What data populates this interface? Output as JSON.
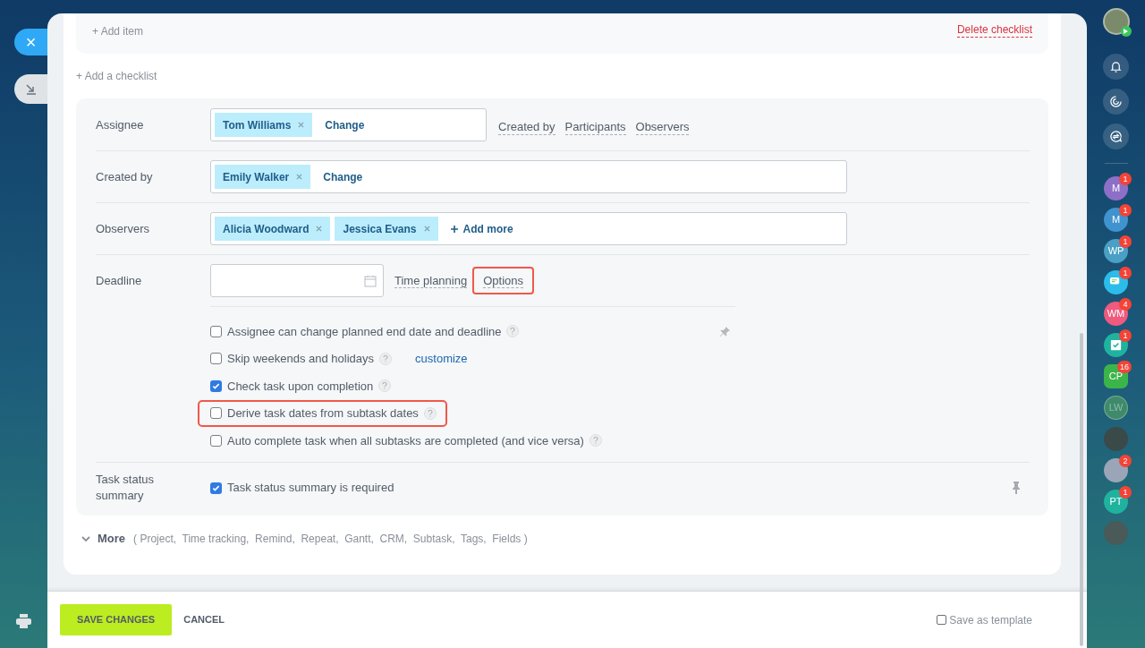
{
  "left_strip": {
    "close": "×"
  },
  "checklist": {
    "add_item": "+ Add item",
    "delete": "Delete checklist",
    "add_checklist": "+ Add a checklist"
  },
  "rows": [
    {
      "label": "Assignee",
      "people": [
        "Tom Williams"
      ],
      "action": "Change",
      "plus": false,
      "wide": false,
      "links": [
        "Created by",
        "Participants",
        "Observers"
      ]
    },
    {
      "label": "Created by",
      "people": [
        "Emily Walker"
      ],
      "action": "Change",
      "plus": false,
      "wide": true,
      "links": []
    },
    {
      "label": "Observers",
      "people": [
        "Alicia Woodward",
        "Jessica Evans"
      ],
      "action": "Add more",
      "plus": true,
      "wide": true,
      "links": []
    }
  ],
  "deadline": {
    "label": "Deadline",
    "links": [
      {
        "text": "Time planning",
        "highlighted": false
      },
      {
        "text": "Options",
        "highlighted": true
      }
    ]
  },
  "options": [
    {
      "label": "Assignee can change planned end date and deadline",
      "checked": false,
      "highlighted": false,
      "pin": true
    },
    {
      "label": "Skip weekends and holidays",
      "checked": false,
      "highlighted": false,
      "pin": false,
      "link": "customize"
    },
    {
      "label": "Check task upon completion",
      "checked": true,
      "highlighted": false,
      "pin": false
    },
    {
      "label": "Derive task dates from subtask dates",
      "checked": false,
      "highlighted": true,
      "pin": false
    },
    {
      "label": "Auto complete task when all subtasks are completed (and vice versa)",
      "checked": false,
      "highlighted": false,
      "pin": false
    }
  ],
  "status_summary": {
    "label": "Task status summary",
    "option": "Task status summary is required",
    "checked": true
  },
  "more": {
    "label": "More",
    "items": "( Project,  Time tracking,  Remind,  Repeat,  Gantt,  CRM,  Subtask,  Tags,  Fields )"
  },
  "footer": {
    "save": "SAVE CHANGES",
    "cancel": "CANCEL",
    "template": "Save as template",
    "template_checked": false
  },
  "sidebar": [
    {
      "kind": "profile",
      "color": "#7a8a6a"
    },
    {
      "kind": "bell"
    },
    {
      "kind": "spiral"
    },
    {
      "kind": "chat-swap"
    },
    {
      "kind": "initials",
      "text": "M",
      "color": "#8e6fc7",
      "badge": "1"
    },
    {
      "kind": "initials",
      "text": "M",
      "color": "#3f93cf",
      "badge": "1"
    },
    {
      "kind": "initials",
      "text": "WP",
      "color": "#4aa0c4",
      "badge": "1"
    },
    {
      "kind": "messages",
      "color": "#2bbcea",
      "badge": "1"
    },
    {
      "kind": "initials",
      "text": "WM",
      "color": "#ef5a7e",
      "badge": "4"
    },
    {
      "kind": "task",
      "color": "#1fb39f",
      "badge": "1"
    },
    {
      "kind": "hexagon",
      "text": "CP",
      "color": "#3bb54a",
      "badge": "16"
    },
    {
      "kind": "faded",
      "text": "LW",
      "color": "#3e8a6a"
    },
    {
      "kind": "photo",
      "color": "#3a4a48"
    },
    {
      "kind": "photo",
      "color": "#9aa6b8",
      "badge": "2"
    },
    {
      "kind": "initials",
      "text": "PT",
      "color": "#1fb39f",
      "badge": "1"
    },
    {
      "kind": "photo",
      "color": "#4a5a58"
    }
  ]
}
